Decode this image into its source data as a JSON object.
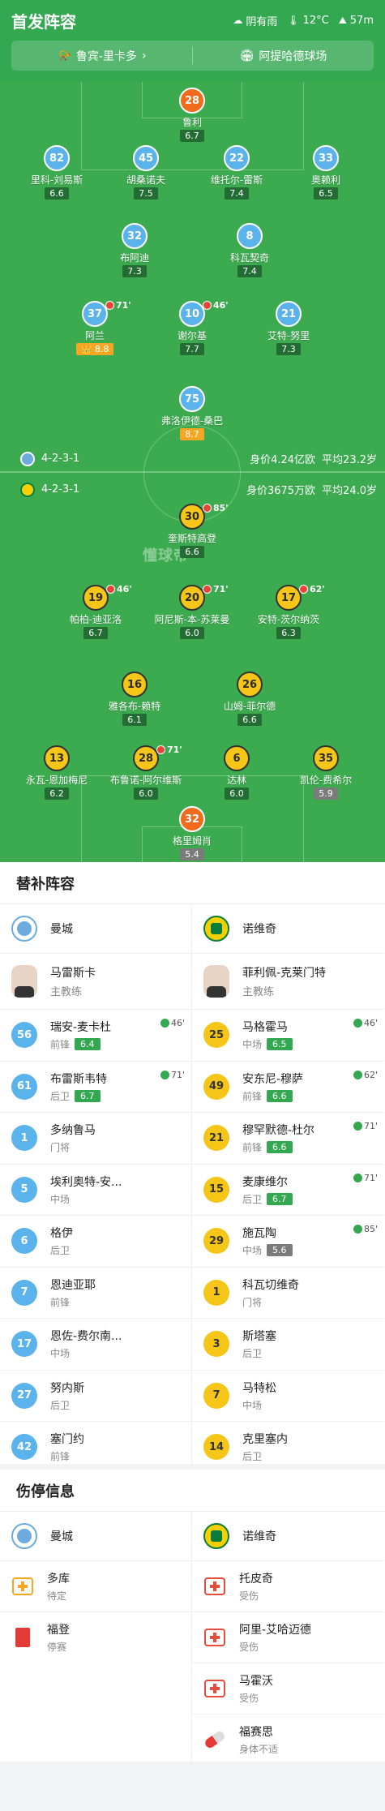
{
  "header": {
    "title": "首发阵容",
    "weather": "阴有雨",
    "temp": "12°C",
    "altitude": "57m",
    "match": "鲁宾-里卡多",
    "venue": "阿提哈德球场"
  },
  "pitch": {
    "watermark": "懂球帝",
    "home_formation": "4-2-3-1",
    "home_value": "身价4.24亿欧",
    "home_age": "平均23.2岁",
    "away_formation": "4-2-3-1",
    "away_value": "身价3675万欧",
    "away_age": "平均24.0岁"
  },
  "home_players": [
    {
      "num": "28",
      "name": "鲁利",
      "rating": "6.7",
      "color": "org"
    },
    {
      "num": "82",
      "name": "里科-刘易斯",
      "rating": "6.6"
    },
    {
      "num": "45",
      "name": "胡桑诺夫",
      "rating": "7.5"
    },
    {
      "num": "22",
      "name": "维托尔-雷斯",
      "rating": "7.4"
    },
    {
      "num": "33",
      "name": "奥赖利",
      "rating": "6.5"
    },
    {
      "num": "32",
      "name": "布阿迪",
      "rating": "7.3"
    },
    {
      "num": "8",
      "name": "科瓦契奇",
      "rating": "7.4"
    },
    {
      "num": "37",
      "name": "阿兰",
      "rating": "8.8",
      "sub": "71'",
      "gold": true
    },
    {
      "num": "10",
      "name": "谢尔基",
      "rating": "7.7",
      "sub": "46'"
    },
    {
      "num": "21",
      "name": "艾特-努里",
      "rating": "7.3"
    },
    {
      "num": "75",
      "name": "弗洛伊德-桑巴",
      "rating": "8.7",
      "gold": true
    }
  ],
  "away_players": [
    {
      "num": "30",
      "name": "奎斯特高登",
      "rating": "6.6",
      "sub": "85'"
    },
    {
      "num": "19",
      "name": "帕柏-迪亚洛",
      "rating": "6.7",
      "sub": "46'"
    },
    {
      "num": "20",
      "name": "阿尼斯-本-苏莱曼",
      "rating": "6.0",
      "sub": "71'"
    },
    {
      "num": "17",
      "name": "安特-茨尔纳茨",
      "rating": "6.3",
      "sub": "62'"
    },
    {
      "num": "16",
      "name": "雅各布-赖特",
      "rating": "6.1"
    },
    {
      "num": "26",
      "name": "山姆-菲尔德",
      "rating": "6.6"
    },
    {
      "num": "13",
      "name": "永瓦-恩加梅尼",
      "rating": "6.2"
    },
    {
      "num": "28",
      "name": "布鲁诺-阿尔维斯",
      "rating": "6.0",
      "sub": "71'"
    },
    {
      "num": "6",
      "name": "达林",
      "rating": "6.0"
    },
    {
      "num": "35",
      "name": "凯伦-费希尔",
      "rating": "5.9"
    },
    {
      "num": "32",
      "name": "格里姆肖",
      "rating": "5.4",
      "color": "org"
    }
  ],
  "subs": {
    "heading": "替补阵容",
    "home_team": "曼城",
    "away_team": "诺维奇",
    "home_manager": {
      "name": "马雷斯卡",
      "role": "主教练"
    },
    "away_manager": {
      "name": "菲利佩-克莱门特",
      "role": "主教练"
    },
    "home": [
      {
        "num": "56",
        "name": "瑞安-麦卡杜",
        "pos": "前锋",
        "rating": "6.4",
        "min": "46'"
      },
      {
        "num": "61",
        "name": "布雷斯韦特",
        "pos": "后卫",
        "rating": "6.7",
        "min": "71'"
      },
      {
        "num": "1",
        "name": "多纳鲁马",
        "pos": "门将"
      },
      {
        "num": "5",
        "name": "埃利奥特-安...",
        "pos": "中场"
      },
      {
        "num": "6",
        "name": "格伊",
        "pos": "后卫"
      },
      {
        "num": "7",
        "name": "恩迪亚耶",
        "pos": "前锋"
      },
      {
        "num": "17",
        "name": "恩佐-费尔南...",
        "pos": "中场"
      },
      {
        "num": "27",
        "name": "努内斯",
        "pos": "后卫"
      },
      {
        "num": "42",
        "name": "塞门约",
        "pos": "前锋"
      }
    ],
    "away": [
      {
        "num": "25",
        "name": "马格霍马",
        "pos": "中场",
        "rating": "6.5",
        "min": "46'"
      },
      {
        "num": "49",
        "name": "安东尼-穆萨",
        "pos": "前锋",
        "rating": "6.6",
        "min": "62'"
      },
      {
        "num": "21",
        "name": "穆罕默德-杜尔",
        "pos": "前锋",
        "rating": "6.6",
        "min": "71'"
      },
      {
        "num": "15",
        "name": "麦康维尔",
        "pos": "后卫",
        "rating": "6.7",
        "min": "71'"
      },
      {
        "num": "29",
        "name": "施瓦陶",
        "pos": "中场",
        "rating": "5.6",
        "min": "85'",
        "gray": true
      },
      {
        "num": "1",
        "name": "科瓦切维奇",
        "pos": "门将"
      },
      {
        "num": "3",
        "name": "斯塔塞",
        "pos": "后卫"
      },
      {
        "num": "7",
        "name": "马特松",
        "pos": "中场"
      },
      {
        "num": "14",
        "name": "克里塞内",
        "pos": "后卫"
      }
    ]
  },
  "injuries": {
    "heading": "伤停信息",
    "home_team": "曼城",
    "away_team": "诺维奇",
    "home": [
      {
        "name": "多库",
        "status": "待定",
        "icon": "medkit-orange"
      },
      {
        "name": "福登",
        "status": "停赛",
        "icon": "red-card"
      }
    ],
    "away": [
      {
        "name": "托皮奇",
        "status": "受伤",
        "icon": "medkit"
      },
      {
        "name": "阿里-艾哈迈德",
        "status": "受伤",
        "icon": "medkit"
      },
      {
        "name": "马霍沃",
        "status": "受伤",
        "icon": "medkit"
      },
      {
        "name": "福赛思",
        "status": "身体不适",
        "icon": "pill"
      }
    ]
  }
}
